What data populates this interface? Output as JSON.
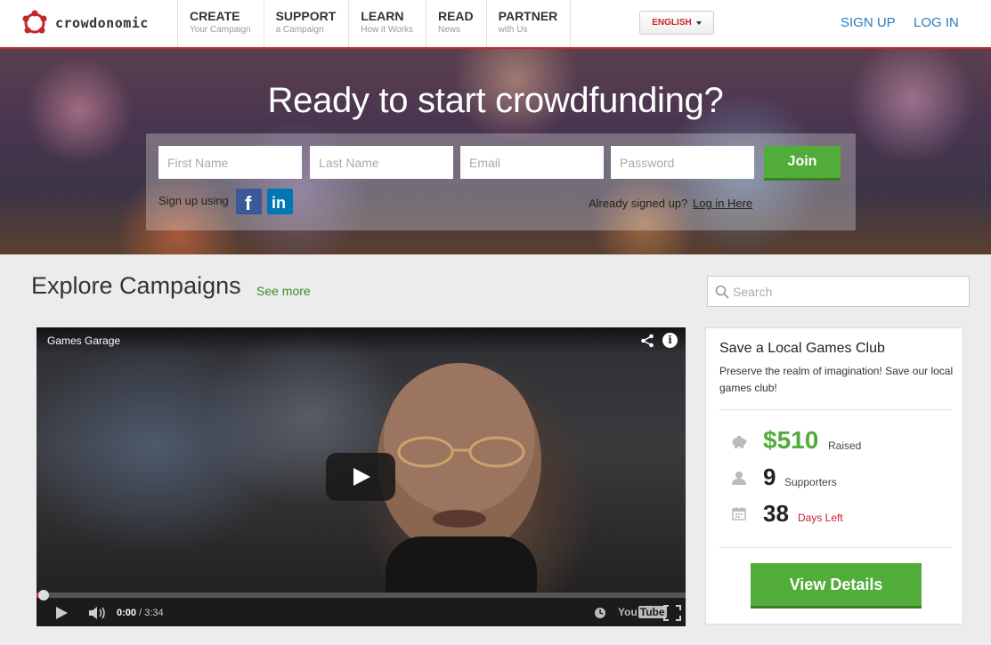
{
  "brand": {
    "name": "crowdonomic",
    "accent": "#c4262e"
  },
  "nav": [
    {
      "label": "CREATE",
      "sub": "Your Campaign"
    },
    {
      "label": "SUPPORT",
      "sub": "a Campaign"
    },
    {
      "label": "LEARN",
      "sub": "How it Works"
    },
    {
      "label": "READ",
      "sub": "News"
    },
    {
      "label": "PARTNER",
      "sub": "with Us"
    }
  ],
  "language": {
    "selected": "ENGLISH"
  },
  "auth": {
    "signup": "SIGN UP",
    "login": "LOG IN"
  },
  "hero": {
    "title": "Ready to start crowdfunding?",
    "fields": {
      "first_name": "First Name",
      "last_name": "Last Name",
      "email": "Email",
      "password": "Password"
    },
    "join": "Join",
    "signup_using": "Sign up using",
    "social": {
      "facebook_icon": "f",
      "linkedin_icon": "in"
    },
    "already": "Already signed up?",
    "login_here": "Log in Here"
  },
  "explore": {
    "title": "Explore Campaigns",
    "see_more": "See more",
    "search_placeholder": "Search"
  },
  "video": {
    "title": "Games Garage",
    "current_time": "0:00",
    "duration": "/ 3:34",
    "progress_fraction": 0.01,
    "info_icon": "i",
    "youtube_you": "You",
    "youtube_tube": "Tube"
  },
  "campaign": {
    "title": "Save a Local Games Club",
    "description": "Preserve the realm of imagination! Save our local games club!",
    "raised_value": "$510",
    "raised_label": "Raised",
    "supporters_value": "9",
    "supporters_label": "Supporters",
    "days_value": "38",
    "days_label": "Days Left",
    "button": "View Details",
    "colors": {
      "raised": "#52ac3a",
      "days_left": "#c4262e"
    }
  }
}
